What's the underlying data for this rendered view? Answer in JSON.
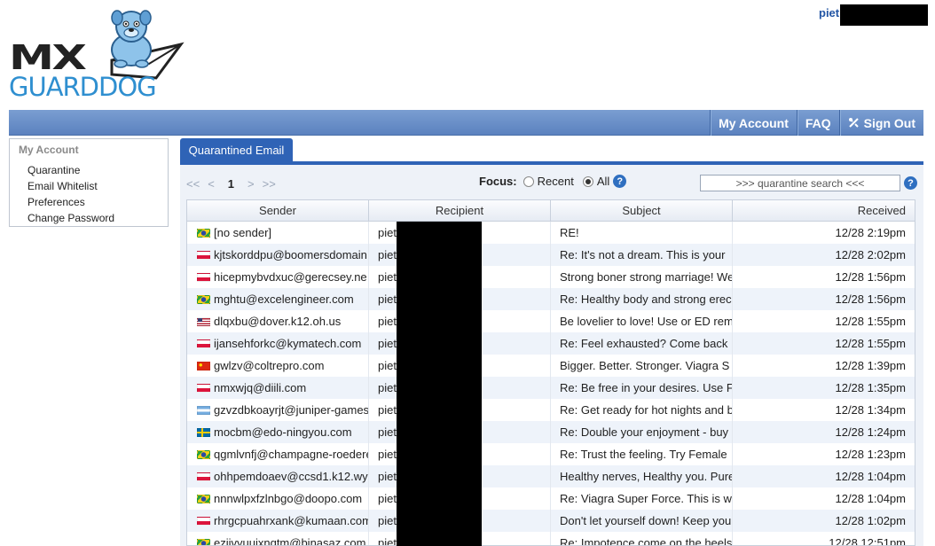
{
  "brand": {
    "line1": "MX",
    "line2": "GUARDDOG"
  },
  "user": {
    "name_visible": "piet"
  },
  "topnav": [
    {
      "label": "My Account",
      "icon": ""
    },
    {
      "label": "FAQ",
      "icon": ""
    },
    {
      "label": "Sign Out",
      "icon": "sign-out-icon"
    }
  ],
  "sidebar": {
    "heading": "My Account",
    "items": [
      "Quarantine",
      "Email Whitelist",
      "Preferences",
      "Change Password"
    ]
  },
  "tab": {
    "label": "Quarantined Email"
  },
  "pager": {
    "first": "<<",
    "prev": "<",
    "current": "1",
    "next": ">",
    "last": ">>"
  },
  "focus": {
    "label": "Focus:",
    "options": [
      "Recent",
      "All"
    ],
    "selected": "All"
  },
  "search": {
    "value": ">>> quarantine search <<<"
  },
  "table": {
    "columns": [
      "Sender",
      "Recipient",
      "Subject",
      "Received"
    ],
    "rows": [
      {
        "flag": "br",
        "sender": "[no sender]",
        "recipient": "piet",
        "subject": "RE!",
        "received": "12/28 2:19pm"
      },
      {
        "flag": "pl",
        "sender": "kjtskorddpu@boomersdomain.",
        "recipient": "piet",
        "subject": "Re: It's not a dream. This is your",
        "received": "12/28 2:02pm"
      },
      {
        "flag": "pl",
        "sender": "hicepmybvdxuc@gerecsey.ne",
        "recipient": "piet",
        "subject": "Strong boner  strong marriage! We",
        "received": "12/28 1:56pm"
      },
      {
        "flag": "br",
        "sender": "mghtu@excelengineer.com",
        "recipient": "piet",
        "subject": "Re: Healthy body and strong erec",
        "received": "12/28 1:56pm"
      },
      {
        "flag": "us",
        "sender": "dlqxbu@dover.k12.oh.us",
        "recipient": "piet",
        "subject": "Be lovelier to love! Use or ED rem",
        "received": "12/28 1:55pm"
      },
      {
        "flag": "pl",
        "sender": "ijansehforkc@kymatech.com",
        "recipient": "piet",
        "subject": "Re: Feel exhausted? Come back",
        "received": "12/28 1:55pm"
      },
      {
        "flag": "cn",
        "sender": "gwlzv@coltrepro.com",
        "recipient": "piet",
        "subject": "Bigger. Better. Stronger. Viagra S",
        "received": "12/28 1:39pm"
      },
      {
        "flag": "pl",
        "sender": "nmxwjq@diili.com",
        "recipient": "piet",
        "subject": "Re: Be free in your desires. Use F",
        "received": "12/28 1:35pm"
      },
      {
        "flag": "ar",
        "sender": "gzvzdbkoayrjt@juniper-games",
        "recipient": "piet",
        "subject": "Re: Get ready for hot nights and b",
        "received": "12/28 1:34pm"
      },
      {
        "flag": "se",
        "sender": "mocbm@edo-ningyou.com",
        "recipient": "piet",
        "subject": "Re: Double your enjoyment - buy",
        "received": "12/28 1:24pm"
      },
      {
        "flag": "br",
        "sender": "qgmlvnfj@champagne-roedere",
        "recipient": "piet",
        "subject": "Re: Trust the feeling. Try Female",
        "received": "12/28 1:23pm"
      },
      {
        "flag": "pl",
        "sender": "ohhpemdoaev@ccsd1.k12.wy",
        "recipient": "piet",
        "subject": "Healthy nerves, Healthy you. Pure",
        "received": "12/28 1:04pm"
      },
      {
        "flag": "br",
        "sender": "nnnwlpxfzlnbgo@doopo.com",
        "recipient": "piet",
        "subject": "Re: Viagra Super Force. This is w",
        "received": "12/28 1:04pm"
      },
      {
        "flag": "pl",
        "sender": "rhrgcpuahrxank@kumaan.com",
        "recipient": "piet",
        "subject": "Don't let yourself down! Keep you",
        "received": "12/28 1:02pm"
      },
      {
        "flag": "br",
        "sender": "ezijvyuujxnqtm@binasaz.com",
        "recipient": "piet",
        "subject": "Re: Impotence come on the heels",
        "received": "12/28 12:51pm"
      }
    ]
  }
}
